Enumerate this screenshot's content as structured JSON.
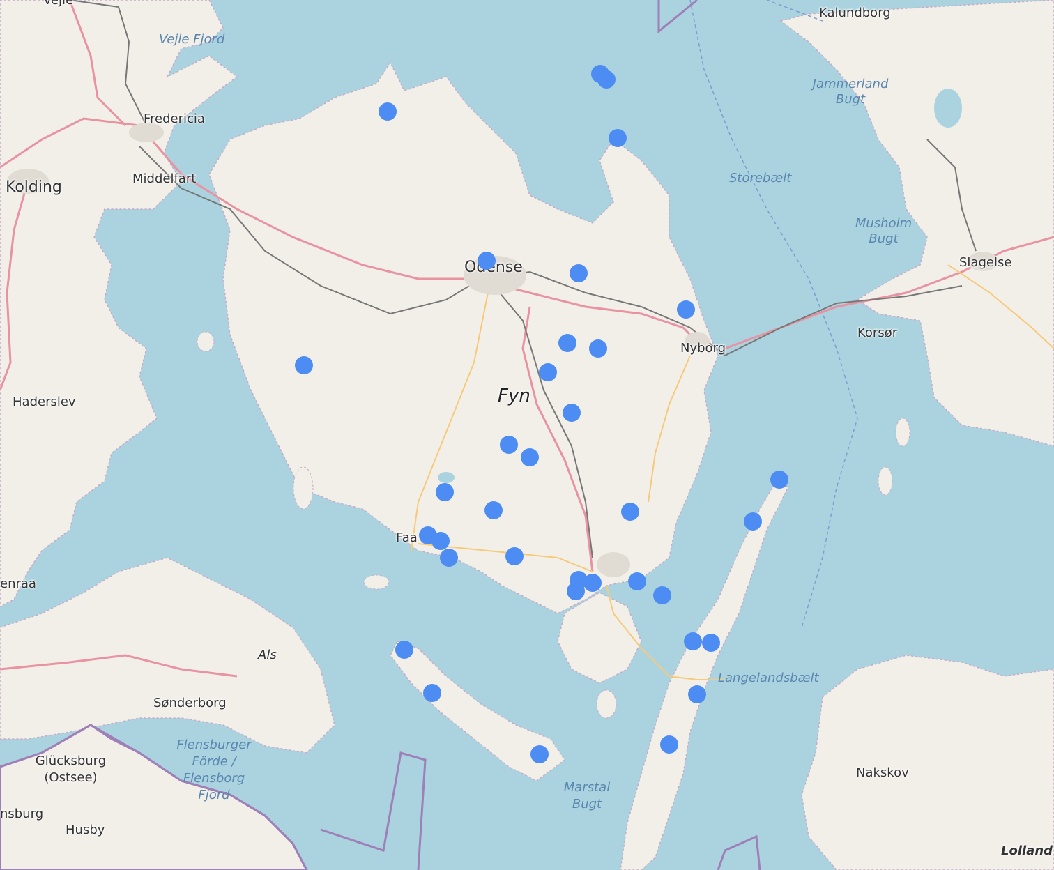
{
  "map": {
    "labels": {
      "vejle": "Vejle",
      "kalundborg": "Kalundborg",
      "vejle_fjord": "Vejle Fjord",
      "fredericia": "Fredericia",
      "jammerland_bugt": "Jammerland Bugt",
      "kolding": "Kolding",
      "middelfart": "Middelfart",
      "storebaelt": "Storebælt",
      "musholm_bugt": "Musholm Bugt",
      "odense": "Odense",
      "slagelse": "Slagelse",
      "korsor": "Korsør",
      "nyborg": "Nyborg",
      "haderslev": "Haderslev",
      "fyn": "Fyn",
      "faaborg": "Faa",
      "aabenraa": "enraa",
      "als": "Als",
      "langelandsbaelt": "Langelandsbælt",
      "sonderborg": "Sønderborg",
      "flensburger_forde": "Flensburger Förde / Flensborg Fjord",
      "glucksburg": "Glücksburg (Ostsee)",
      "nakskov": "Nakskov",
      "marstal_bugt": "Marstal Bugt",
      "flensburg": "nsburg",
      "husby": "Husby",
      "lolland": "Lolland"
    },
    "colors": {
      "sea": "#aad3df",
      "land": "#f2efe9",
      "marker": "#4d8df3",
      "major_road": "#e892a2",
      "secondary_road": "#f7c97a",
      "railway": "#777777",
      "border": "#9e7fb8"
    },
    "marker_icon": "circle-marker-icon",
    "marker_count": 35
  }
}
